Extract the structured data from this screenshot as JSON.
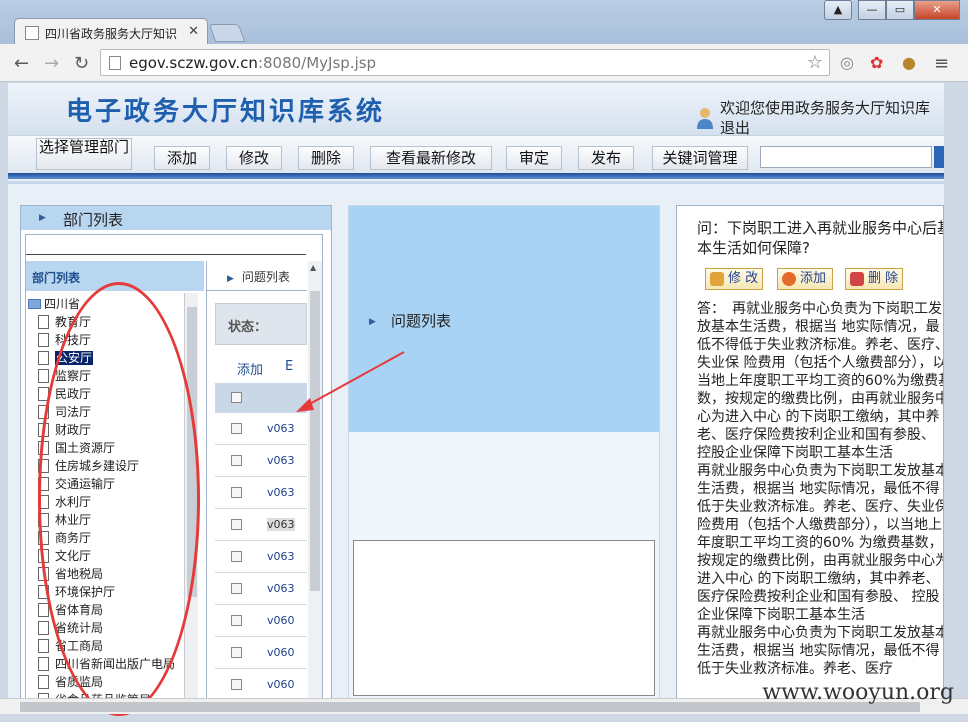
{
  "browser": {
    "tab_title": "四川省政务服务大厅知识",
    "url_host": "egov.sczw.gov.cn",
    "url_rest": ":8080/MyJsp.jsp"
  },
  "header": {
    "site_title": "电子政务大厅知识库系统",
    "welcome": "欢迎您使用政务服务大厅知识库",
    "logout": "退出"
  },
  "menu": {
    "select_dept": "选择管理部门",
    "add": "添加",
    "modify": "修改",
    "delete": "删除",
    "latest": "查看最新修改",
    "review": "审定",
    "publish": "发布",
    "keywords": "关键词管理"
  },
  "left": {
    "panel_title": "部门列表",
    "dept_list_title": "部门列表",
    "tree_root": "四川省",
    "departments": [
      "教育厅",
      "科技厅",
      "公安厅",
      "监察厅",
      "民政厅",
      "司法厅",
      "财政厅",
      "国土资源厅",
      "住房城乡建设厅",
      "交通运输厅",
      "水利厅",
      "林业厅",
      "商务厅",
      "文化厅",
      "省地税局",
      "环境保护厅",
      "省体育局",
      "省统计局",
      "省工商局",
      "四川省新闻出版广电局",
      "省质监局",
      "省食品药品监管局"
    ],
    "question_tab": "问题列表",
    "status_label": "状态：",
    "add_link": "添加",
    "add_link2": "E",
    "rows": [
      "v063",
      "v063",
      "v063",
      "v063",
      "v063",
      "v063",
      "v060",
      "v060",
      "v060"
    ]
  },
  "middle": {
    "panel_title": "问题列表"
  },
  "right": {
    "question": "问：下岗职工进入再就业服务中心后基本生活如何保障?",
    "btn_modify": "修 改",
    "btn_add": "添加",
    "btn_delete": "删 除",
    "answer": "答：　再就业服务中心负责为下岗职工发放基本生活费，根据当 地实际情况，最低不得低于失业救济标准。养老、医疗、失业保 险费用（包括个人缴费部分），以当地上年度职工平均工资的60%为缴费基数，按规定的缴费比例，由再就业服务中心为进入中心 的下岗职工缴纳，其中养老、医疗保险费按利企业和国有参股、 控股企业保障下岗职工基本生活\n再就业服务中心负责为下岗职工发放基本生活费，根据当 地实际情况，最低不得低于失业救济标准。养老、医疗、失业保 险费用（包括个人缴费部分），以当地上年度职工平均工资的60% 为缴费基数，按规定的缴费比例，由再就业服务中心为进入中心 的下岗职工缴纳，其中养老、医疗保险费按利企业和国有参股、 控股企业保障下岗职工基本生活\n再就业服务中心负责为下岗职工发放基本生活费，根据当 地实际情况，最低不得低于失业救济标准。养老、医疗"
  },
  "watermark": "www.wooyun.org",
  "icons": [
    "page-icon",
    "star-icon",
    "user-icon",
    "folder-icon",
    "document-icon",
    "triangle-right-icon",
    "wrench-icon",
    "plus-icon",
    "scissors-icon"
  ],
  "colors": {
    "accent": "#1f5fae",
    "annotation": "#e53a3a",
    "selected": "#0a246a"
  }
}
